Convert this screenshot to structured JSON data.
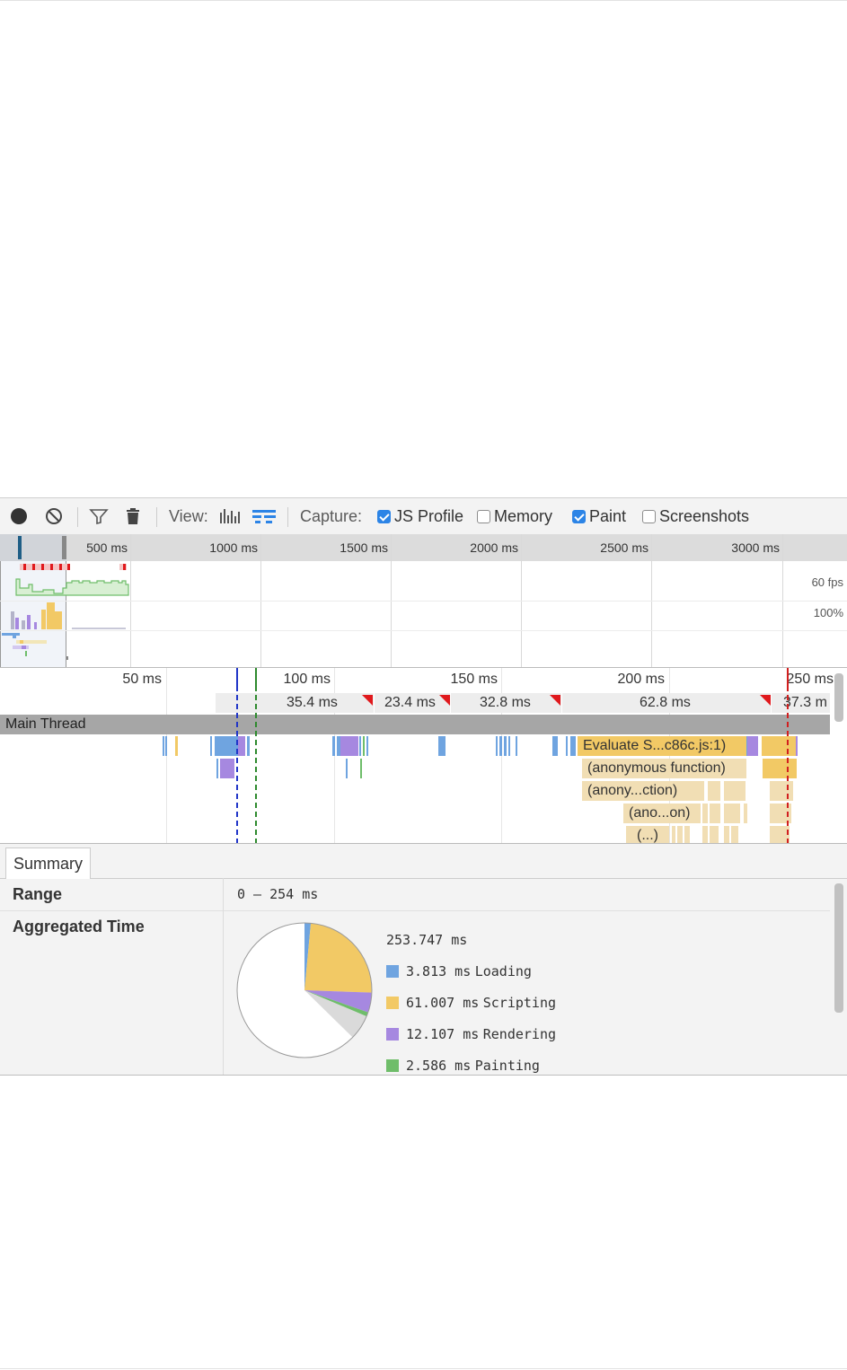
{
  "toolbar": {
    "view_label": "View:",
    "capture_label": "Capture:",
    "options": [
      {
        "label": "JS Profile",
        "checked": true
      },
      {
        "label": "Memory",
        "checked": false
      },
      {
        "label": "Paint",
        "checked": true
      },
      {
        "label": "Screenshots",
        "checked": false
      }
    ]
  },
  "overview": {
    "ticks": [
      "500 ms",
      "1000 ms",
      "1500 ms",
      "2000 ms",
      "2500 ms",
      "3000 ms"
    ],
    "fps_label": "60 fps",
    "cpu_label": "100%"
  },
  "flamechart": {
    "ticks": [
      "50 ms",
      "100 ms",
      "150 ms",
      "200 ms",
      "250 ms"
    ],
    "frames": [
      "35.4 ms",
      "23.4 ms",
      "32.8 ms",
      "62.8 ms",
      "37.3 m"
    ],
    "thread_label": "Main Thread",
    "events": [
      {
        "label": "Evaluate S...c86c.js:1)"
      },
      {
        "label": "(anonymous function)"
      },
      {
        "label": "(anony...ction)"
      },
      {
        "label": "(ano...on)"
      },
      {
        "label": "(...)"
      }
    ]
  },
  "summary": {
    "tab": "Summary",
    "range_key": "Range",
    "range_value": "0 – 254 ms",
    "agg_key": "Aggregated Time",
    "total": "253.747 ms",
    "legend": [
      {
        "value": "3.813 ms",
        "name": "Loading",
        "color": "#6fa4e0"
      },
      {
        "value": "61.007 ms",
        "name": "Scripting",
        "color": "#f2c965"
      },
      {
        "value": "12.107 ms",
        "name": "Rendering",
        "color": "#a688e0"
      },
      {
        "value": "2.586 ms",
        "name": "Painting",
        "color": "#6fbd6a"
      }
    ]
  },
  "colors": {
    "loading": "#6fa4e0",
    "scripting": "#f2c965",
    "rendering": "#a688e0",
    "painting": "#6fbd6a",
    "js_frame": "#f1deb4",
    "frame_flag": "#e0191d"
  }
}
